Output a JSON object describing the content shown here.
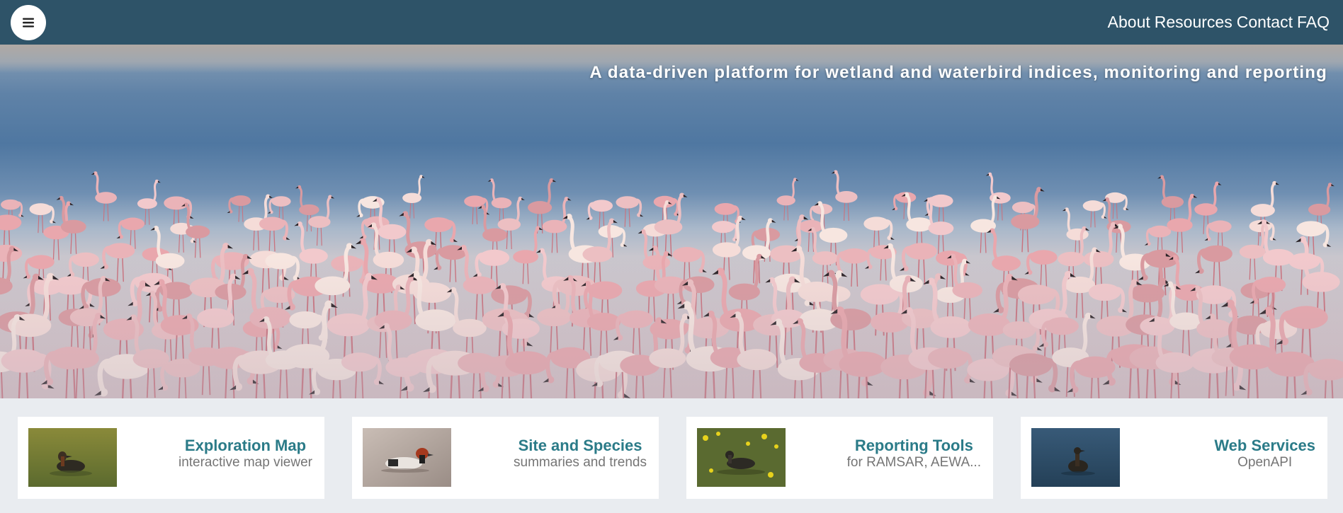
{
  "header": {
    "menu_icon": "hamburger-icon",
    "nav": [
      {
        "label": "About"
      },
      {
        "label": "Resources"
      },
      {
        "label": "Contact"
      },
      {
        "label": "FAQ"
      }
    ],
    "background_color": "#2e5368"
  },
  "hero": {
    "tagline": "A data-driven platform for wetland and waterbird indices, monitoring and reporting",
    "image": "flamingos-wading-photo"
  },
  "cards": [
    {
      "title": "Exploration Map",
      "subtitle": "interactive map viewer",
      "image": "grebe-on-water-photo"
    },
    {
      "title": "Site and Species",
      "subtitle": "summaries and trends",
      "image": "duck-swimming-photo"
    },
    {
      "title": "Reporting Tools",
      "subtitle": "for RAMSAR, AEWA...",
      "image": "grebe-among-flowers-photo"
    },
    {
      "title": "Web Services",
      "subtitle": "OpenAPI",
      "image": "grebe-dark-water-photo"
    }
  ],
  "colors": {
    "accent": "#2b7b88",
    "muted_text": "#757575",
    "page_bg": "#e9ecf0"
  }
}
